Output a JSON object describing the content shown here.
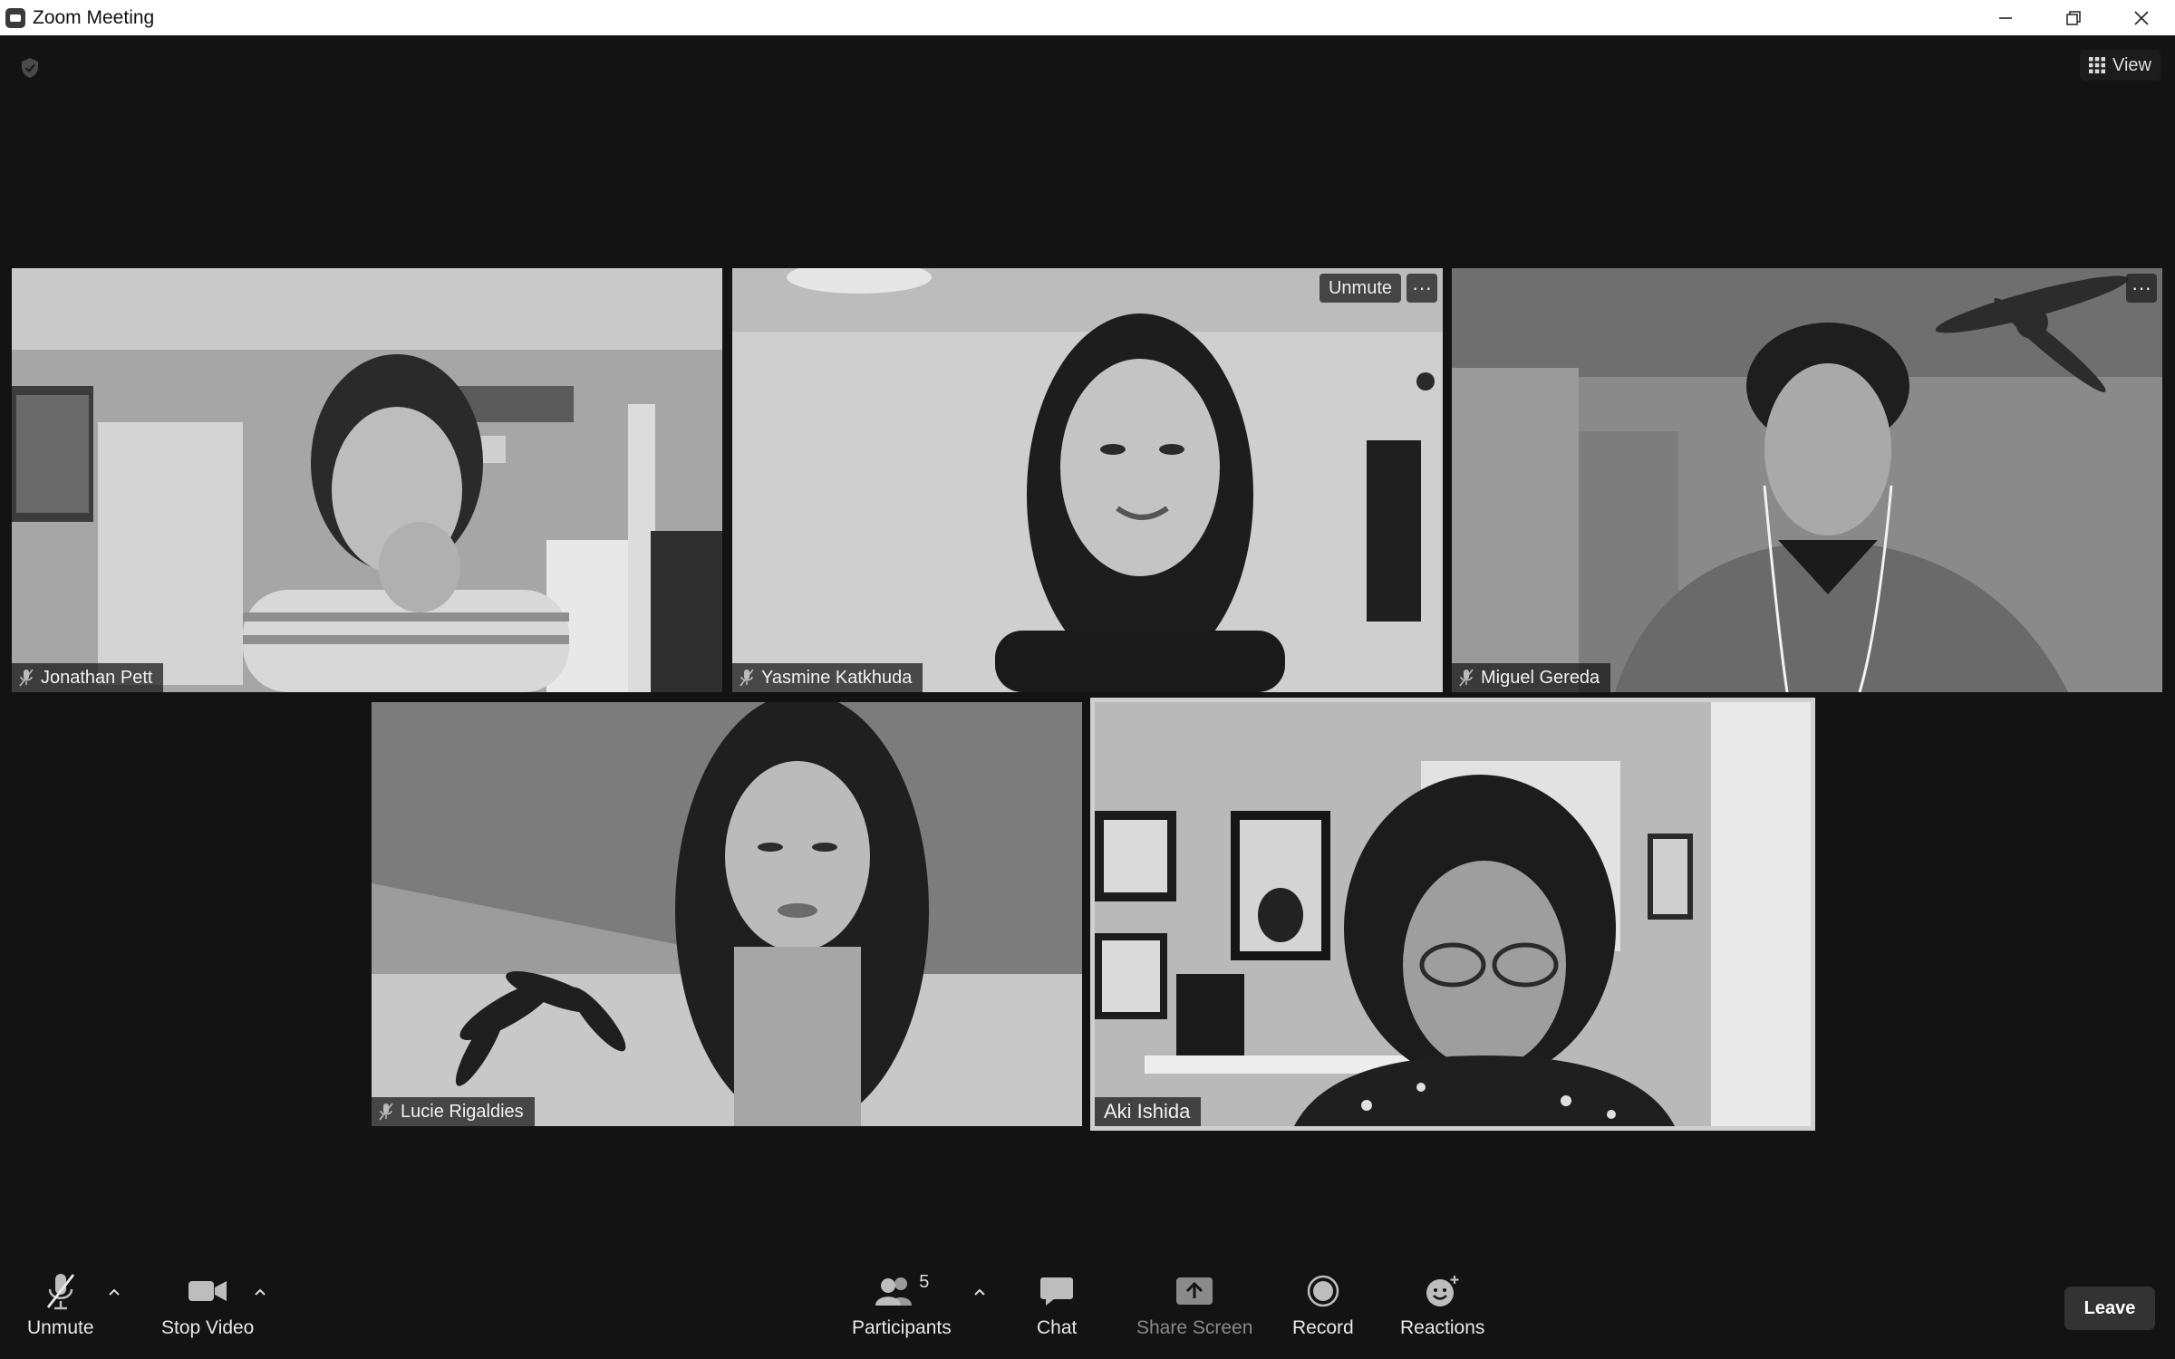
{
  "window": {
    "title": "Zoom Meeting"
  },
  "top_controls": {
    "view_label": "View"
  },
  "participants": [
    {
      "name": "Jonathan Pett",
      "muted": true
    },
    {
      "name": "Yasmine Katkhuda",
      "muted": true,
      "overlay_unmute": "Unmute",
      "overlay_more": "···"
    },
    {
      "name": "Miguel Gereda",
      "muted": true,
      "overlay_more": "···"
    },
    {
      "name": "Lucie Rigaldies",
      "muted": true
    },
    {
      "name": "Aki Ishida",
      "muted": false,
      "active_speaker": true
    }
  ],
  "toolbar": {
    "unmute_label": "Unmute",
    "stop_video_label": "Stop Video",
    "participants_label": "Participants",
    "participants_count": "5",
    "chat_label": "Chat",
    "share_screen_label": "Share Screen",
    "record_label": "Record",
    "reactions_label": "Reactions",
    "leave_label": "Leave"
  },
  "colors": {
    "background": "#131313",
    "titlebar": "#ffffff",
    "active_border": "#cfcfcf"
  }
}
